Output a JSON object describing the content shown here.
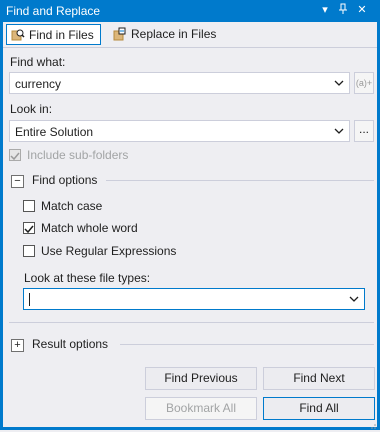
{
  "window": {
    "title": "Find and Replace",
    "controls": {
      "dropdown": "▾",
      "pin": "⊓",
      "close": "✕"
    }
  },
  "tabs": [
    {
      "label": "Find in Files",
      "active": true
    },
    {
      "label": "Replace in Files",
      "active": false
    }
  ],
  "find_what": {
    "label": "Find what:",
    "value": "currency",
    "side_button": "(a)+"
  },
  "look_in": {
    "label": "Look in:",
    "value": "Entire Solution",
    "side_button": "..."
  },
  "include_subfolders": {
    "label": "Include sub-folders",
    "checked": true,
    "disabled": true
  },
  "find_options": {
    "toggle": "−",
    "title": "Find options",
    "match_case": {
      "label": "Match case",
      "checked": false
    },
    "match_whole_word": {
      "label": "Match whole word",
      "checked": true
    },
    "use_regex": {
      "label": "Use Regular Expressions",
      "checked": false
    },
    "file_types": {
      "label": "Look at these file types:",
      "value": ""
    }
  },
  "result_options": {
    "toggle": "+",
    "title": "Result options"
  },
  "buttons": {
    "find_previous": "Find Previous",
    "find_next": "Find Next",
    "bookmark_all": "Bookmark All",
    "find_all": "Find All"
  },
  "colors": {
    "accent": "#007acc",
    "background": "#eeeef2"
  }
}
